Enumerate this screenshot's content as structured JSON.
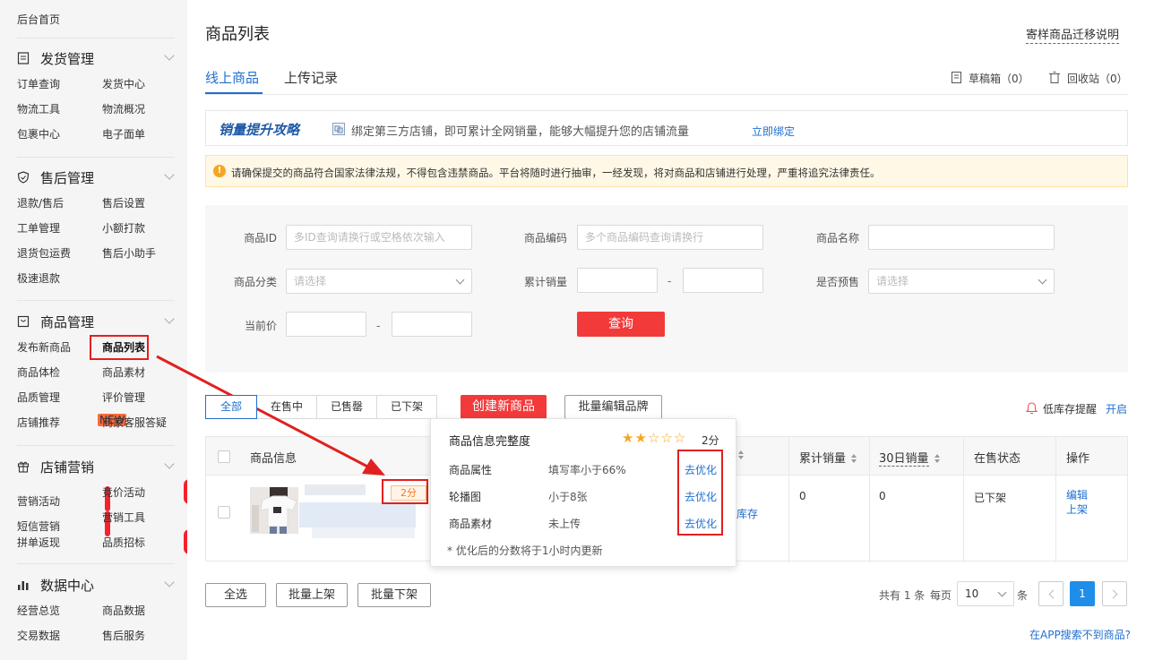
{
  "sidebar": {
    "home": "后台首页",
    "sections": [
      {
        "title": "发货管理",
        "icon": "document-icon",
        "items": [
          "订单查询",
          "发货中心",
          "物流工具",
          "物流概况",
          "包裹中心",
          "电子面单"
        ]
      },
      {
        "title": "售后管理",
        "icon": "shield-icon",
        "items": [
          "退款/售后",
          "售后设置",
          "工单管理",
          "小额打款",
          "退货包运费",
          "售后小助手",
          "极速退款"
        ]
      },
      {
        "title": "商品管理",
        "icon": "box-icon",
        "items": [
          "发布新商品",
          "商品列表",
          "商品体检",
          "商品素材",
          "品质管理",
          "评价管理",
          "店铺推荐",
          "商家客服答疑"
        ],
        "new_tag": "NEW"
      },
      {
        "title": "店铺营销",
        "icon": "gift-icon",
        "items": [
          "营销活动",
          "竞价活动",
          "短信营销",
          "营销工具",
          "拼单返现",
          "品质招标"
        ],
        "badge": "1"
      },
      {
        "title": "数据中心",
        "icon": "bar-chart-icon",
        "items": [
          "经营总览",
          "商品数据",
          "交易数据",
          "售后服务"
        ]
      }
    ]
  },
  "header": {
    "title": "商品列表",
    "migrate_link": "寄样商品迁移说明"
  },
  "tabs": [
    "线上商品",
    "上传记录"
  ],
  "drafts": "草稿箱（0）",
  "recycle": "回收站（0）",
  "promo": {
    "logo": "销量提升攻略",
    "text": "绑定第三方店铺，即可累计全网销量，能够大幅提升您的店铺流量",
    "link": "立即绑定"
  },
  "warning": "请确保提交的商品符合国家法律法规，不得包含违禁商品。平台将随时进行抽审，一经发现，将对商品和店铺进行处理，严重将追究法律责任。",
  "filters": {
    "id_label": "商品ID",
    "id_placeholder": "多ID查询请换行或空格依次输入",
    "code_label": "商品编码",
    "code_placeholder": "多个商品编码查询请换行",
    "name_label": "商品名称",
    "category_label": "商品分类",
    "category_placeholder": "请选择",
    "sales_label": "累计销量",
    "dash": "-",
    "presale_label": "是否预售",
    "presale_placeholder": "请选择",
    "price_label": "当前价",
    "search_button": "查询"
  },
  "status_tabs": [
    "全部",
    "在售中",
    "已售罄",
    "已下架"
  ],
  "create_button": "创建新商品",
  "batch_brand_button": "批量编辑品牌",
  "low_stock": {
    "label": "低库存提醒",
    "toggle": "开启"
  },
  "table": {
    "headers": [
      "商品信息",
      "累计销量",
      "30日销量",
      "在售状态",
      "操作"
    ],
    "row": {
      "score": "2分",
      "stock_link": "库存",
      "sales": "0",
      "sales30": "0",
      "status": "已下架",
      "actions": [
        "编辑",
        "上架"
      ]
    }
  },
  "popover": {
    "title": "商品信息完整度",
    "rating": 2,
    "rating_max": 5,
    "score": "2分",
    "rows": [
      {
        "name": "商品属性",
        "desc": "填写率小于66%",
        "link": "去优化"
      },
      {
        "name": "轮播图",
        "desc": "小于8张",
        "link": "去优化"
      },
      {
        "name": "商品素材",
        "desc": "未上传",
        "link": "去优化"
      }
    ],
    "note": "* 优化后的分数将于1小时内更新"
  },
  "bottom": {
    "select_all": "全选",
    "batch_on": "批量上架",
    "batch_off": "批量下架"
  },
  "pagination": {
    "total": "共有 1 条",
    "per_page_label": "每页",
    "per_page": "10",
    "unit": "条",
    "current": "1"
  },
  "app_link": "在APP搜索不到商品?",
  "colors": {
    "accent": "#1f6fd1",
    "primary_red": "#f23a3a",
    "annotation_red": "#e12020",
    "star": "#f5a623"
  }
}
